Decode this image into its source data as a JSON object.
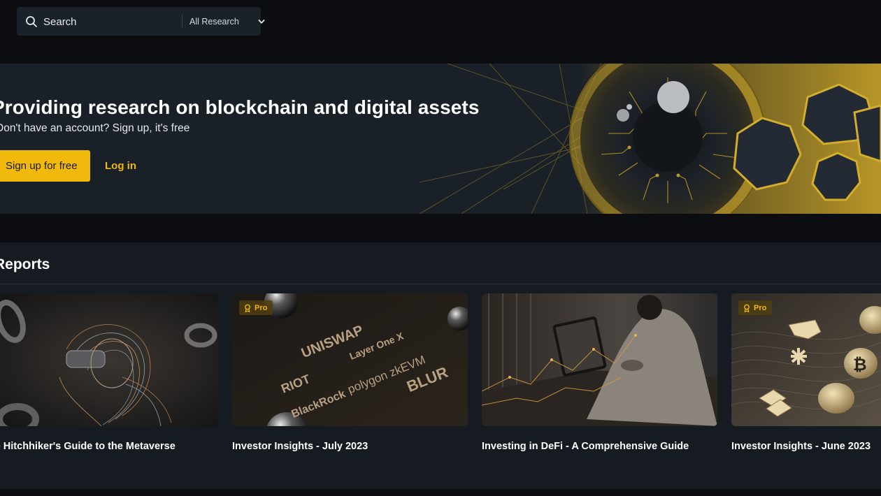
{
  "search": {
    "placeholder": "Search",
    "scope_label": "All Research"
  },
  "hero": {
    "title": "Providing research on blockchain and digital assets",
    "subtitle": "Don't have an account? Sign up, it's free",
    "signup_label": "Sign up for free",
    "login_label": "Log in"
  },
  "reports": {
    "heading": "Reports",
    "pro_label": "Pro",
    "cards": [
      {
        "title": "The Hitchhiker's Guide to the Metaverse",
        "pro": false
      },
      {
        "title": "Investor Insights - July 2023",
        "pro": true,
        "logos": [
          "UNISWAP",
          "Layer One X",
          "RIOT",
          "BlackRock",
          "polygon zkEVM",
          "BLUR"
        ]
      },
      {
        "title": "Investing in DeFi - A Comprehensive Guide",
        "pro": false
      },
      {
        "title": "Investor Insights - June 2023",
        "pro": true
      }
    ]
  },
  "colors": {
    "accent": "#f0b90b",
    "background": "#0b0d10",
    "panel": "#1a2028",
    "section": "#161b21"
  },
  "icons": {
    "search": "search-icon",
    "chevron": "chevron-down-icon",
    "pro": "award-icon"
  }
}
